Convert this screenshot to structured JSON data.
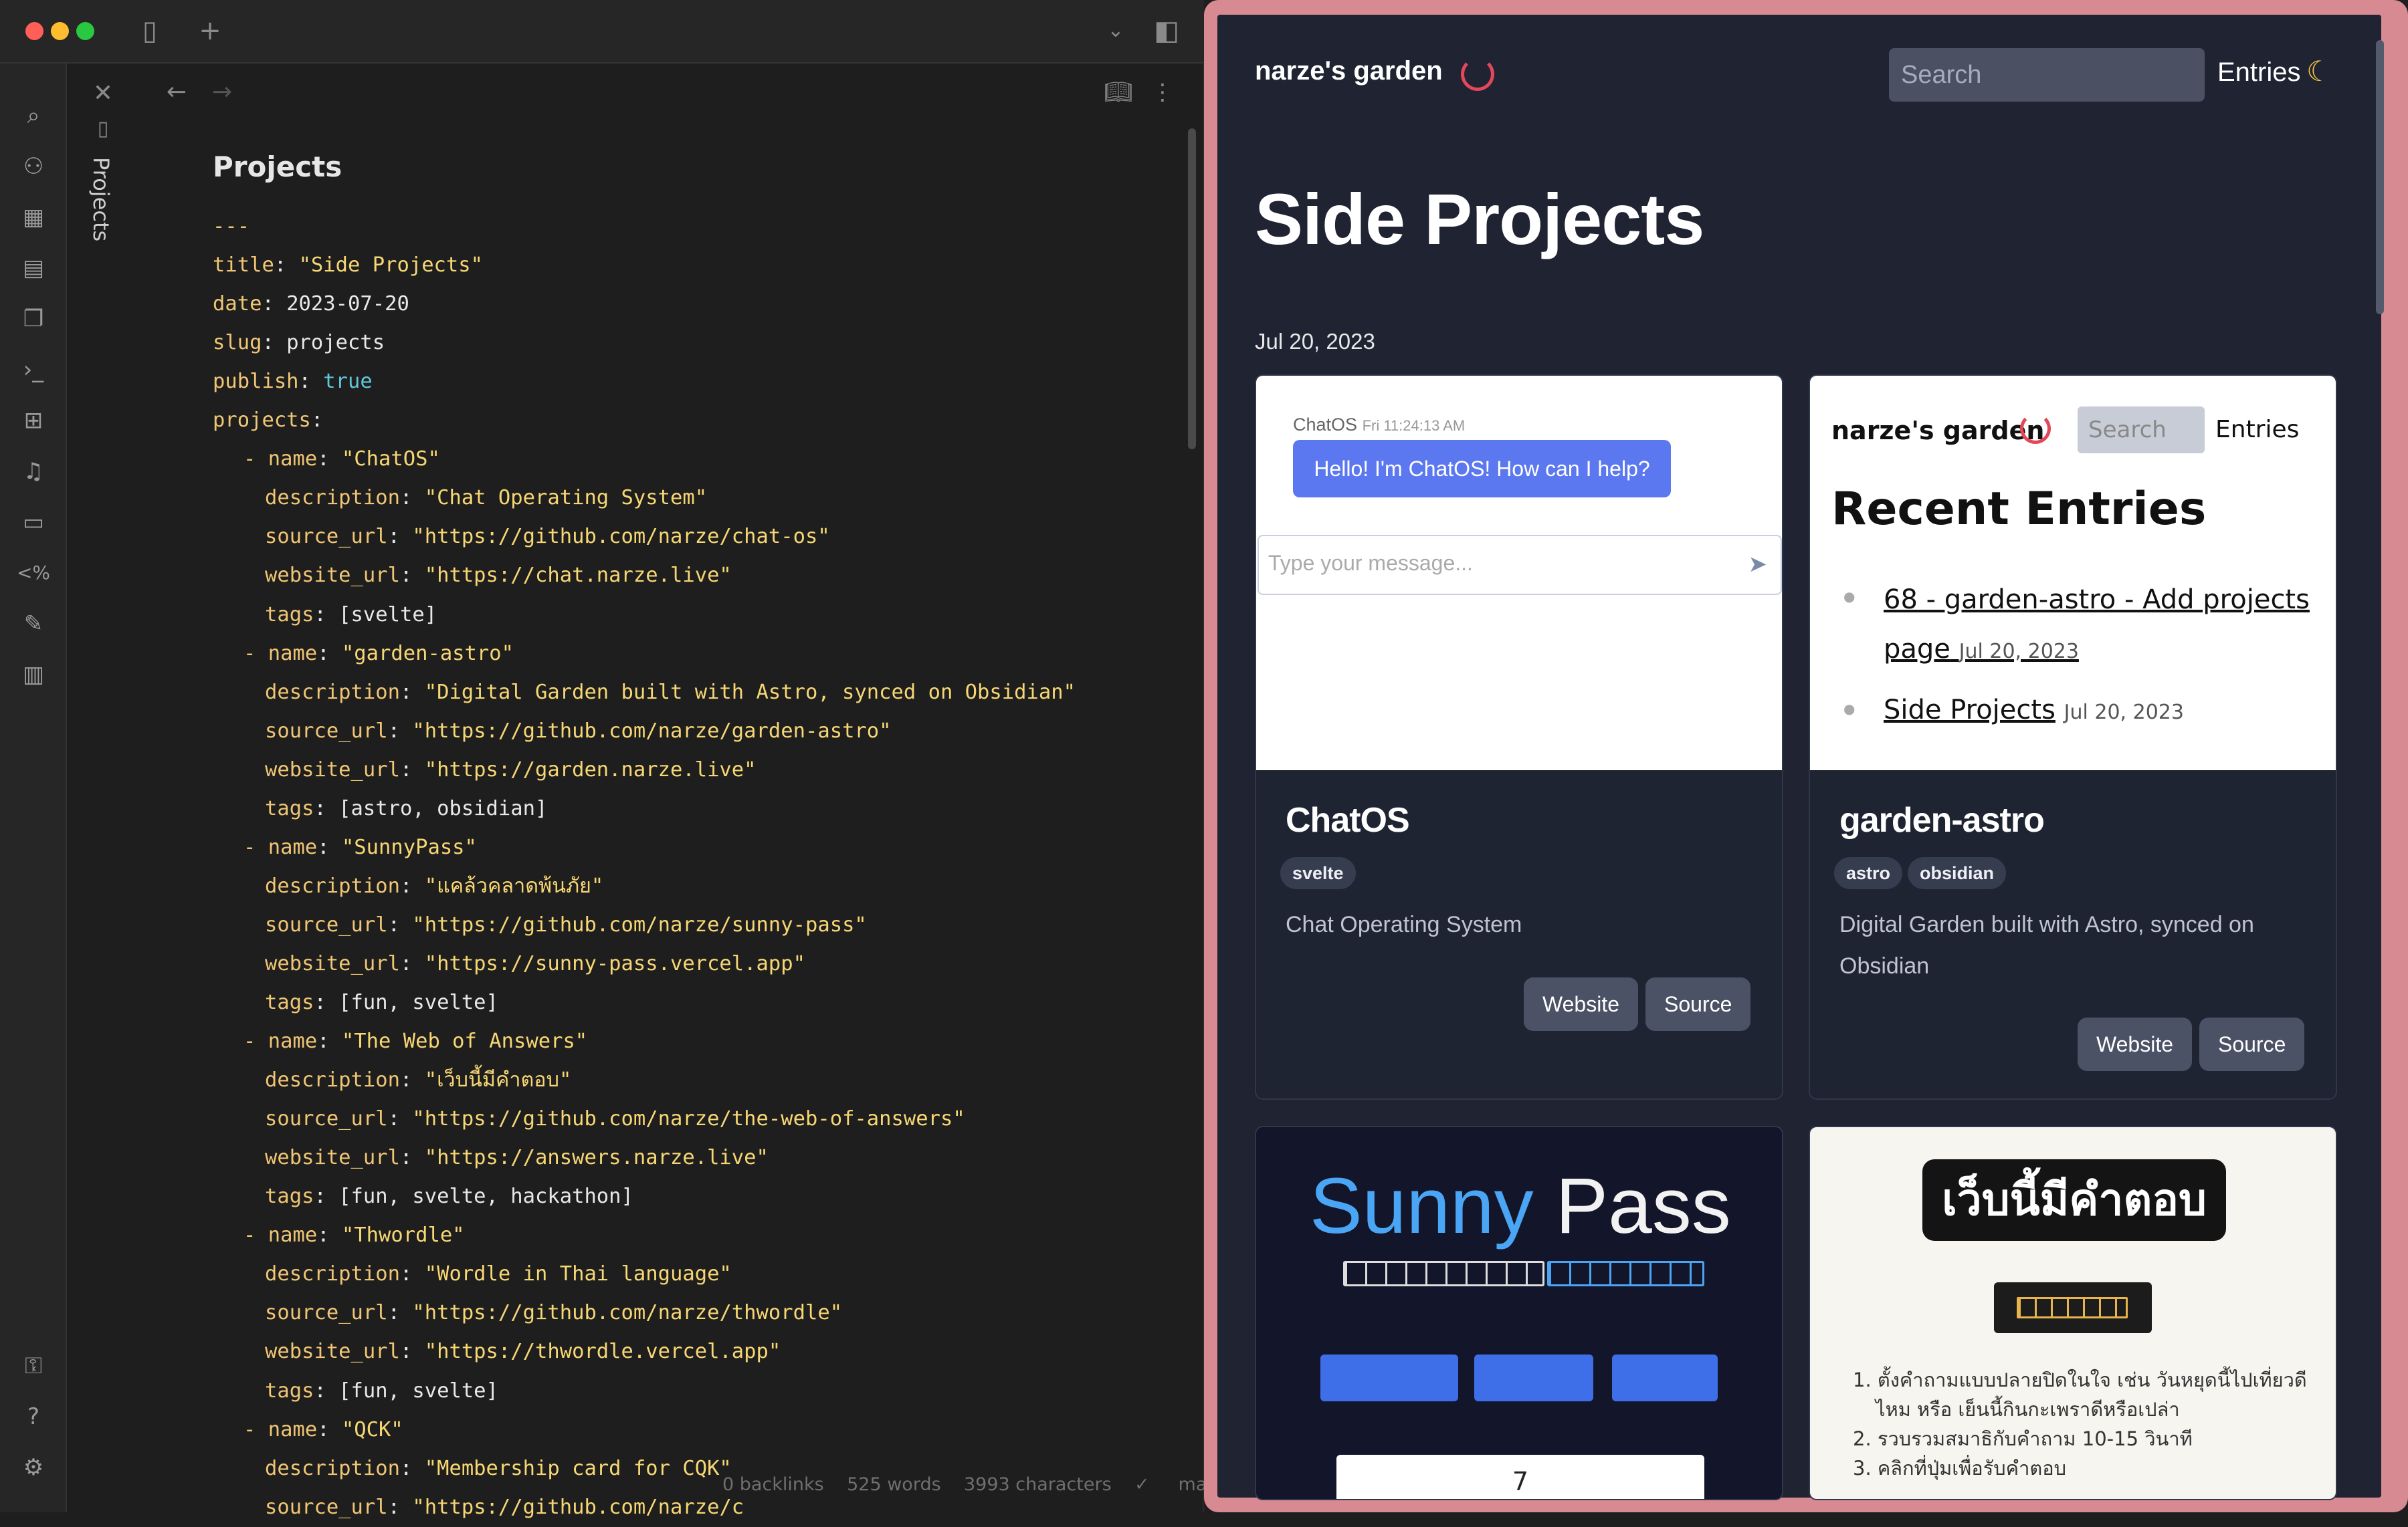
{
  "editor": {
    "tab_label": "Projects",
    "title": "Projects",
    "frontmatter": [
      {
        "indent": 0,
        "key": "",
        "value": "---",
        "kind": "dash"
      },
      {
        "indent": 0,
        "key": "title",
        "value": "\"Side Projects\"",
        "kind": "s"
      },
      {
        "indent": 0,
        "key": "date",
        "value": "2023-07-20",
        "kind": "v"
      },
      {
        "indent": 0,
        "key": "slug",
        "value": "projects",
        "kind": "v"
      },
      {
        "indent": 0,
        "key": "publish",
        "value": "true",
        "kind": "b"
      },
      {
        "indent": 0,
        "key": "projects",
        "value": "",
        "kind": "v"
      },
      {
        "indent": 1,
        "key": "- name",
        "value": "\"ChatOS\"",
        "kind": "s"
      },
      {
        "indent": 2,
        "key": "description",
        "value": "\"Chat Operating System\"",
        "kind": "s"
      },
      {
        "indent": 2,
        "key": "source_url",
        "value": "\"https://github.com/narze/chat-os\"",
        "kind": "s"
      },
      {
        "indent": 2,
        "key": "website_url",
        "value": "\"https://chat.narze.live\"",
        "kind": "s"
      },
      {
        "indent": 2,
        "key": "tags",
        "value": "[svelte]",
        "kind": "v"
      },
      {
        "indent": 1,
        "key": "- name",
        "value": "\"garden-astro\"",
        "kind": "s"
      },
      {
        "indent": 2,
        "key": "description",
        "value": "\"Digital Garden built with Astro, synced on Obsidian\"",
        "kind": "s"
      },
      {
        "indent": 2,
        "key": "source_url",
        "value": "\"https://github.com/narze/garden-astro\"",
        "kind": "s"
      },
      {
        "indent": 2,
        "key": "website_url",
        "value": "\"https://garden.narze.live\"",
        "kind": "s"
      },
      {
        "indent": 2,
        "key": "tags",
        "value": "[astro, obsidian]",
        "kind": "v"
      },
      {
        "indent": 1,
        "key": "- name",
        "value": "\"SunnyPass\"",
        "kind": "s"
      },
      {
        "indent": 2,
        "key": "description",
        "value": "\"แคล้วคลาดพ้นภัย\"",
        "kind": "s"
      },
      {
        "indent": 2,
        "key": "source_url",
        "value": "\"https://github.com/narze/sunny-pass\"",
        "kind": "s"
      },
      {
        "indent": 2,
        "key": "website_url",
        "value": "\"https://sunny-pass.vercel.app\"",
        "kind": "s"
      },
      {
        "indent": 2,
        "key": "tags",
        "value": "[fun, svelte]",
        "kind": "v"
      },
      {
        "indent": 1,
        "key": "- name",
        "value": "\"The Web of Answers\"",
        "kind": "s"
      },
      {
        "indent": 2,
        "key": "description",
        "value": "\"เว็บนี้มีคำตอบ\"",
        "kind": "s"
      },
      {
        "indent": 2,
        "key": "source_url",
        "value": "\"https://github.com/narze/the-web-of-answers\"",
        "kind": "s"
      },
      {
        "indent": 2,
        "key": "website_url",
        "value": "\"https://answers.narze.live\"",
        "kind": "s"
      },
      {
        "indent": 2,
        "key": "tags",
        "value": "[fun, svelte, hackathon]",
        "kind": "v"
      },
      {
        "indent": 1,
        "key": "- name",
        "value": "\"Thwordle\"",
        "kind": "s"
      },
      {
        "indent": 2,
        "key": "description",
        "value": "\"Wordle in Thai language\"",
        "kind": "s"
      },
      {
        "indent": 2,
        "key": "source_url",
        "value": "\"https://github.com/narze/thwordle\"",
        "kind": "s"
      },
      {
        "indent": 2,
        "key": "website_url",
        "value": "\"https://thwordle.vercel.app\"",
        "kind": "s"
      },
      {
        "indent": 2,
        "key": "tags",
        "value": "[fun, svelte]",
        "kind": "v"
      },
      {
        "indent": 1,
        "key": "- name",
        "value": "\"QCK\"",
        "kind": "s"
      },
      {
        "indent": 2,
        "key": "description",
        "value": "\"Membership card for CQK\"",
        "kind": "s"
      },
      {
        "indent": 2,
        "key": "source_url",
        "value": "\"https://github.com/narze/c",
        "kind": "s"
      }
    ],
    "status": {
      "backlinks": "0 backlinks",
      "words": "525 words",
      "characters": "3993 characters",
      "branch": "main"
    }
  },
  "site": {
    "logo": "narze's garden",
    "search_placeholder": "Search",
    "nav_entries": "Entries",
    "heading": "Side Projects",
    "date": "Jul 20, 2023",
    "projects": [
      {
        "name": "ChatOS",
        "tags": [
          "svelte"
        ],
        "description": "Chat Operating System",
        "website_label": "Website",
        "source_label": "Source",
        "preview": {
          "sender": "ChatOS",
          "time": "Fri 11:24:13 AM",
          "message": "Hello! I'm ChatOS! How can I help?",
          "input_placeholder": "Type your message..."
        }
      },
      {
        "name": "garden-astro",
        "tags": [
          "astro",
          "obsidian"
        ],
        "description_1": "Digital Garden built with Astro, synced on",
        "description_2": "Obsidian",
        "website_label": "Website",
        "source_label": "Source",
        "preview": {
          "logo": "narze's garden",
          "search": "Search",
          "entries": "Entries",
          "heading": "Recent Entries",
          "items": [
            {
              "title_1": "68 - garden-astro - Add projects",
              "title_2": "page",
              "date": "Jul 20, 2023"
            },
            {
              "title_1": "Side Projects",
              "title_2": "",
              "date": "Jul 20, 2023"
            }
          ]
        }
      },
      {
        "preview": {
          "logo_word1": "Sunny",
          "logo_word2": "Pass",
          "counter": "7"
        }
      },
      {
        "preview": {
          "title": "เว็บนี้มีคำตอบ",
          "steps": [
            "1. ตั้งคำถามแบบปลายปิดในใจ เช่น วันหยุดนี้ไปเที่ยวดี",
            "ไหม หรือ เย็นนี้กินกะเพราดีหรือเปล่า",
            "2. รวบรวมสมาธิกับคำถาม 10-15 วินาที",
            "3. คลิกที่ปุ่มเพื่อรับคำตอบ"
          ]
        }
      }
    ]
  },
  "colors": {
    "frame": "#d88a92",
    "page_bg": "#1f2332",
    "accent_blue": "#4f7bea",
    "loader": "#e2475a"
  }
}
